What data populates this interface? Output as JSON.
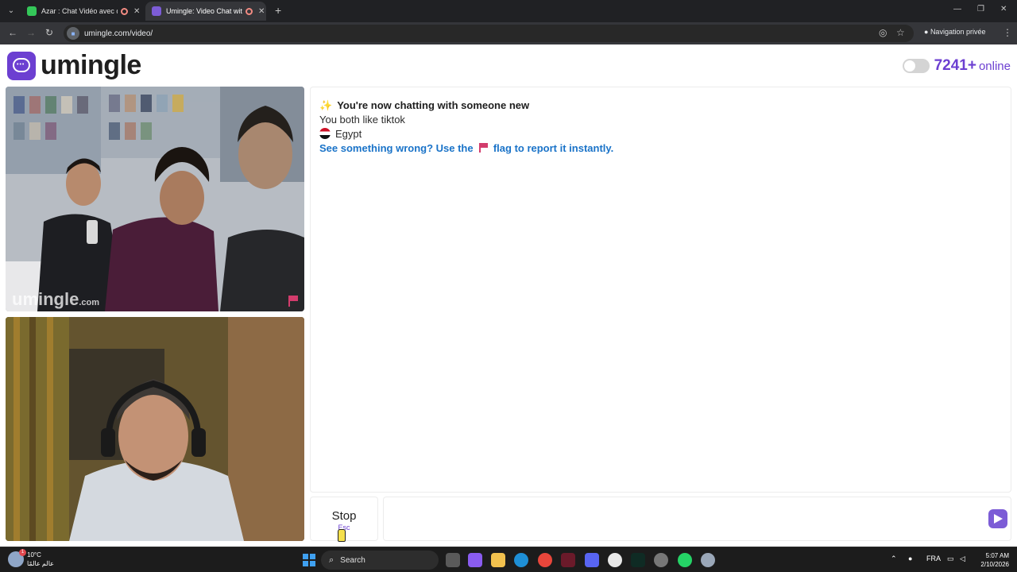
{
  "browser": {
    "tabs": [
      {
        "title": "Azar : Chat Vidéo avec de n",
        "active": false
      },
      {
        "title": "Umingle: Video Chat with S",
        "active": true
      }
    ],
    "url": "umingle.com/video/",
    "private_label": "Navigation privée"
  },
  "site": {
    "logo_text": "umingle",
    "online_count": "7241+",
    "online_label": "online",
    "accent_color": "#6c3fd1"
  },
  "video": {
    "watermark": "umingle",
    "watermark_suffix": ".com"
  },
  "chat": {
    "messages": {
      "intro_icon": "✨",
      "intro": "You're now chatting with someone new",
      "common_interest": "You both like tiktok",
      "country": "Egypt",
      "report_before": "See something wrong? Use the",
      "report_after": "flag to report it instantly."
    },
    "stop_label": "Stop",
    "stop_shortcut": "Esc",
    "input_value": ""
  },
  "taskbar": {
    "temperature": "10°C",
    "weather_caption": "عالم عالمًا",
    "weather_badge": "1",
    "search_label": "Search",
    "language": "FRA",
    "time": "5:07 AM",
    "date": "2/10/2026"
  }
}
